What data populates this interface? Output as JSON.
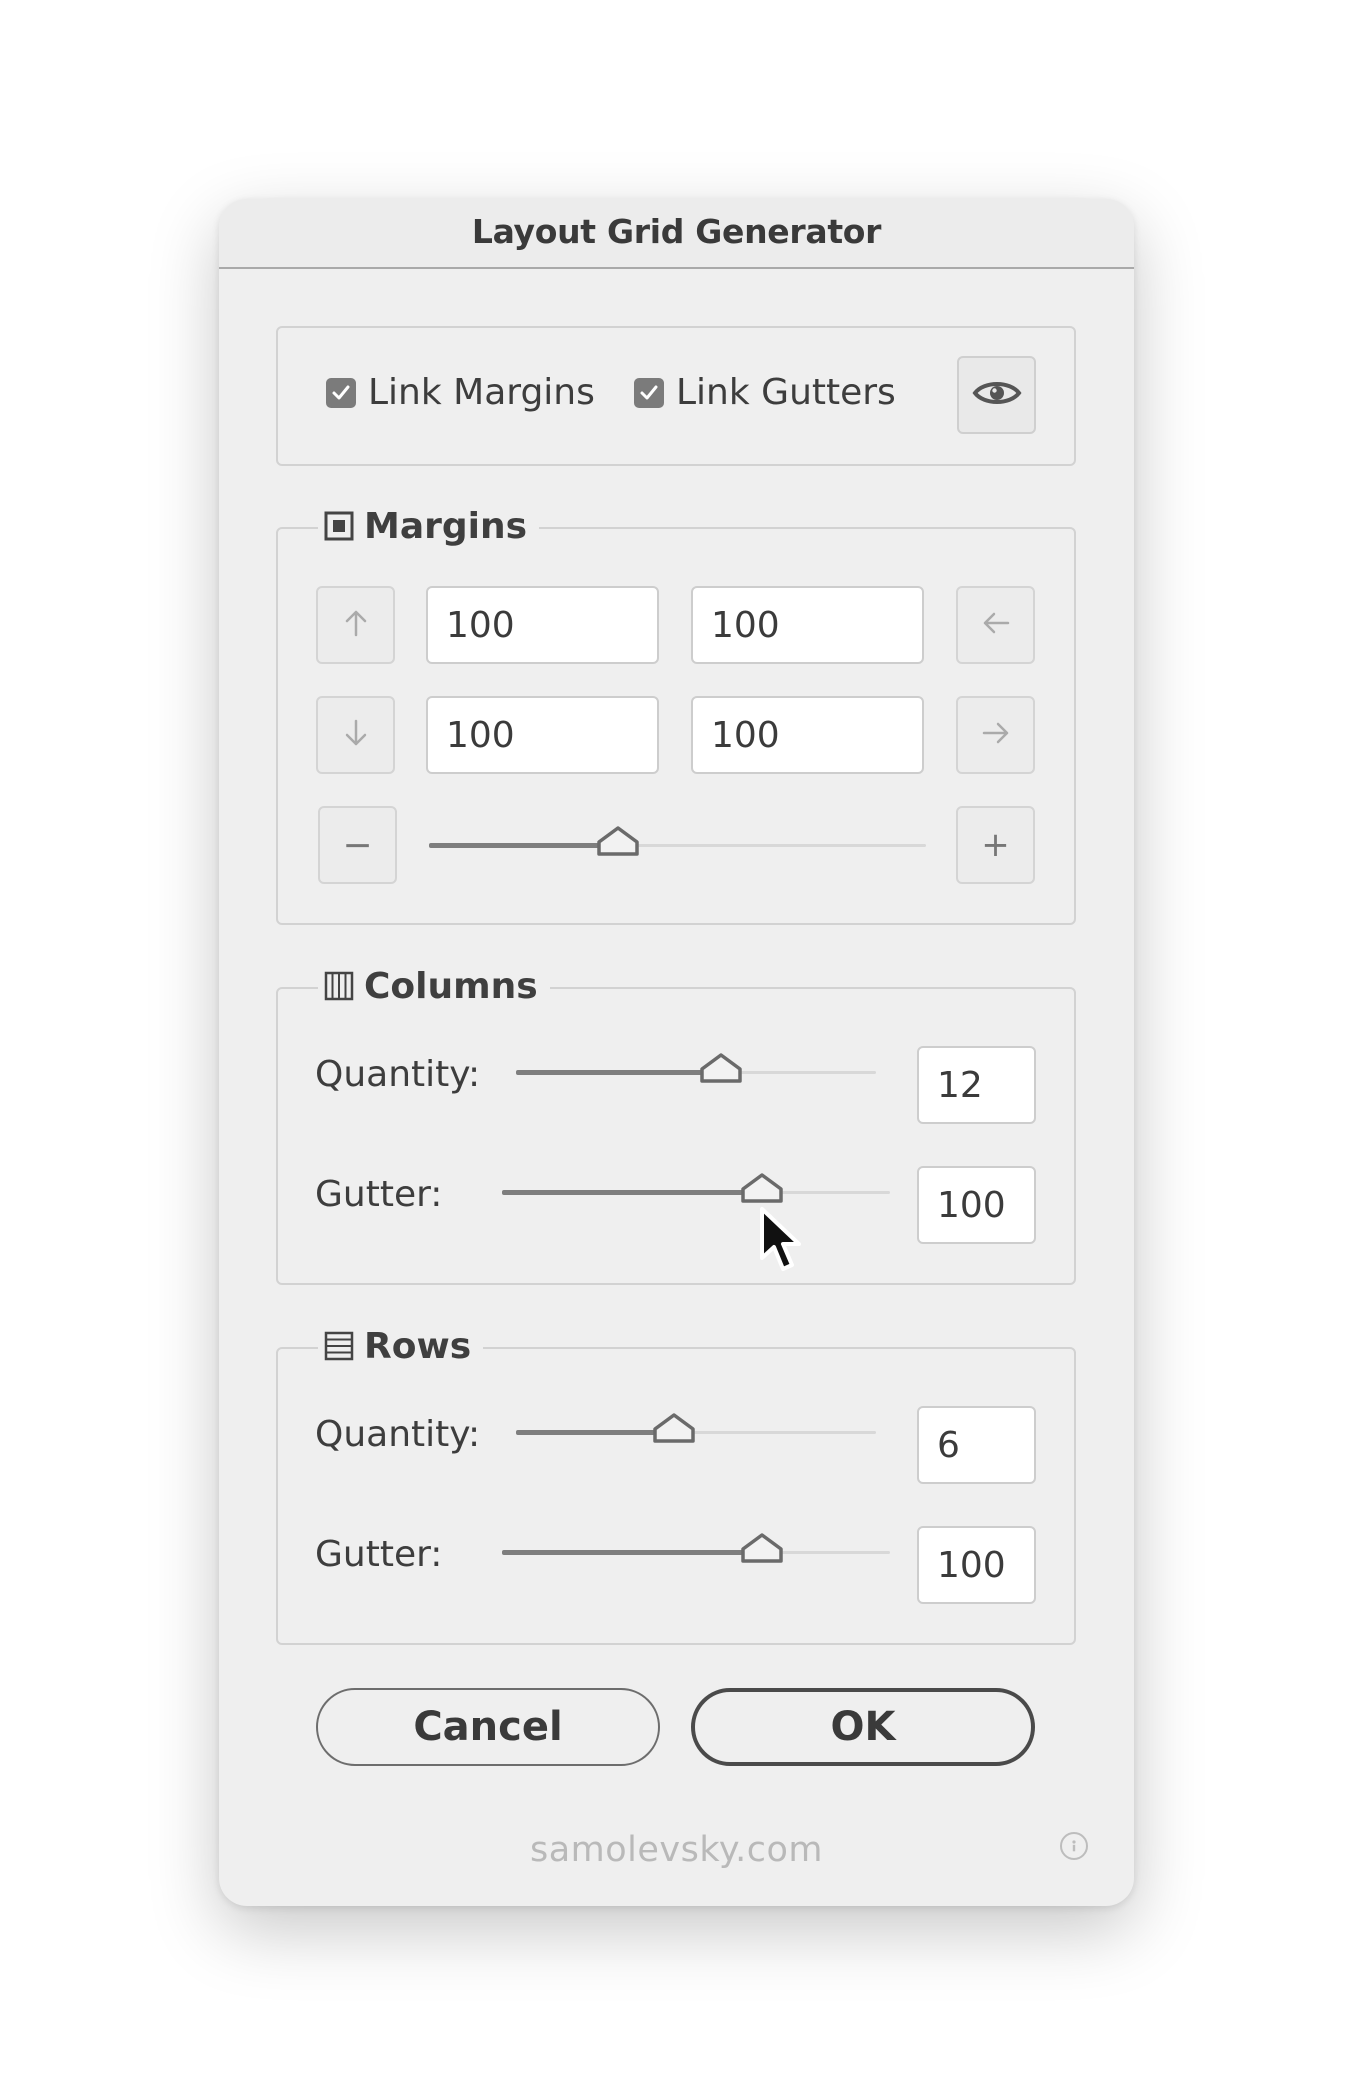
{
  "dialog": {
    "title": "Layout Grid Generator"
  },
  "options": {
    "link_margins": {
      "label": "Link Margins",
      "checked": true
    },
    "link_gutters": {
      "label": "Link Gutters",
      "checked": true
    },
    "preview_icon": "eye-icon"
  },
  "margins": {
    "title": "Margins",
    "icon": "margins-square-icon",
    "top": "100",
    "right": "100",
    "bottom": "100",
    "left": "100",
    "slider_level": 0.38,
    "decrease_label": "−",
    "increase_label": "+"
  },
  "columns": {
    "title": "Columns",
    "icon": "columns-icon",
    "quantity_label": "Quantity:",
    "quantity": "12",
    "quantity_level": 0.57,
    "gutter_label": "Gutter:",
    "gutter": "100",
    "gutter_level": 0.67
  },
  "rows": {
    "title": "Rows",
    "icon": "rows-icon",
    "quantity_label": "Quantity:",
    "quantity": "6",
    "quantity_level": 0.44,
    "gutter_label": "Gutter:",
    "gutter": "100",
    "gutter_level": 0.67
  },
  "actions": {
    "cancel_label": "Cancel",
    "ok_label": "OK"
  },
  "footer": {
    "text": "samolevsky.com",
    "info_icon": "info-icon"
  },
  "colors": {
    "dialog_bg": "#efefef",
    "accent": "#7b7b7b",
    "text": "#3d3d3d"
  }
}
